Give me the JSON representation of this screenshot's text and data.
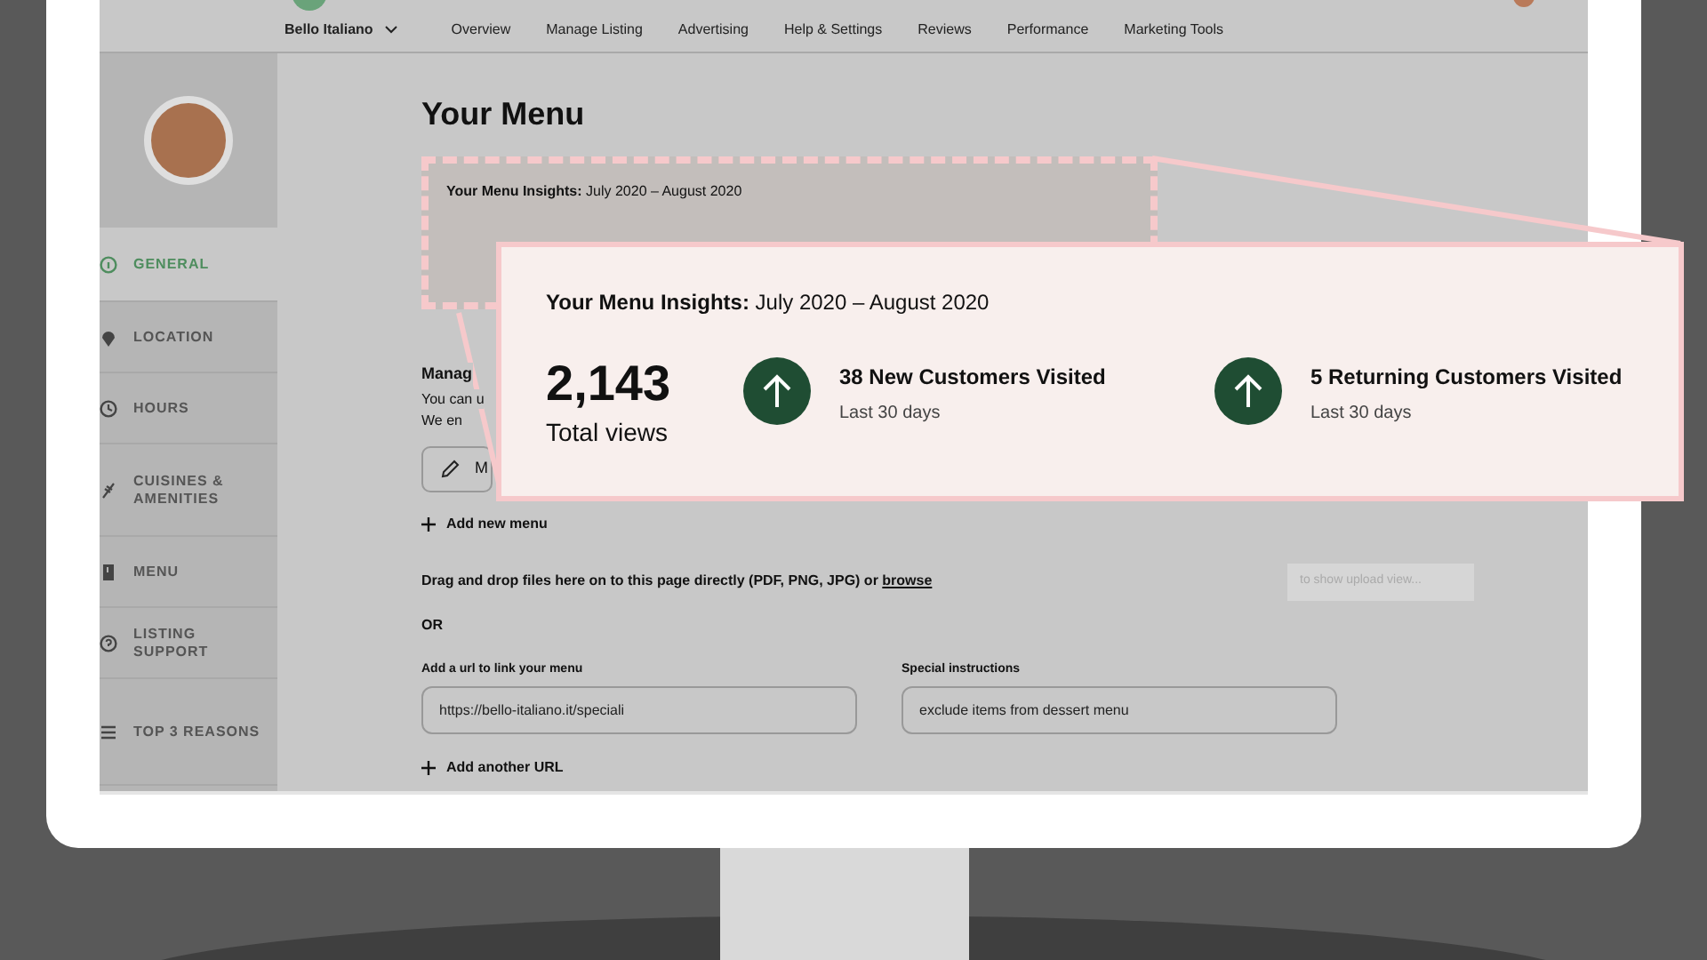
{
  "nav": {
    "brand": "Bello Italiano",
    "items": [
      "Overview",
      "Manage Listing",
      "Advertising",
      "Help & Settings",
      "Reviews",
      "Performance",
      "Marketing Tools"
    ]
  },
  "sidebar": {
    "items": [
      {
        "label": "GENERAL",
        "selected": true
      },
      {
        "label": "LOCATION",
        "selected": false
      },
      {
        "label": "HOURS",
        "selected": false
      },
      {
        "label": "CUISINES & AMENITIES",
        "selected": false
      },
      {
        "label": "MENU",
        "selected": false
      },
      {
        "label": "LISTING SUPPORT",
        "selected": false
      },
      {
        "label": "TOP 3 REASONS",
        "selected": false
      }
    ]
  },
  "page_title": "Your Menu",
  "insights_card": {
    "title": "**Your Menu Insights:** July 2020 – August 2020"
  },
  "manage": {
    "heading": "Manag",
    "lines": [
      "You can u",
      "We en"
    ],
    "button": "M"
  },
  "add_menu": "Add new menu",
  "upload": {
    "text": "Drag and drop files here on to this page directly (PDF, PNG, JPG) or",
    "link": "browse",
    "hint": "to show upload view..."
  },
  "or": "OR",
  "fields": [
    {
      "label": "Add a url to link your menu",
      "value": "https://bello-italiano.it/speciali"
    },
    {
      "label": "Special instructions",
      "value": "exclude items from dessert menu"
    }
  ],
  "add_url": "Add another URL",
  "callout": {
    "title": "**Your Menu Insights:** July 2020 – August 2020",
    "total": "2,143",
    "total_label": "Total views",
    "stats": [
      {
        "title": "38 New Customers Visited",
        "sub": "Last 30 days"
      },
      {
        "title": "5 Returning Customers Visited",
        "sub": "Last 30 days"
      }
    ]
  }
}
